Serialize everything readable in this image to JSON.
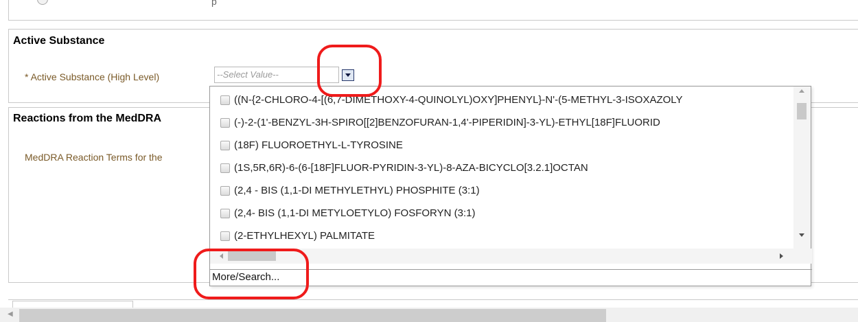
{
  "top_panel": {
    "text": "p"
  },
  "active_substance": {
    "title": "Active Substance",
    "field_label": "* Active Substance (High Level)",
    "select_placeholder": "--Select Value--"
  },
  "reactions": {
    "title": "Reactions from the MedDRA",
    "field_label": "MedDRA Reaction Terms for the"
  },
  "dropdown": {
    "options": [
      "((N-{2-CHLORO-4-[(6,7-DIMETHOXY-4-QUINOLYL)OXY]PHENYL}-N'-(5-METHYL-3-ISOXAZOLY",
      "(-)-2-(1'-BENZYL-3H-SPIRO[[2]BENZOFURAN-1,4'-PIPERIDIN]-3-YL)-ETHYL[18F]FLUORID",
      "(18F) FLUOROETHYL-L-TYROSINE",
      "(1S,5R,6R)-6-(6-[18F]FLUOR-PYRIDIN-3-YL)-8-AZA-BICYCLO[3.2.1]OCTAN",
      "(2,4 - BIS (1,1-DI METHYLETHYL) PHOSPHITE (3:1)",
      "(2,4- BIS (1,1-DI METYLOETYLO) FOSFORYN (3:1)",
      "(2-ETHYLHEXYL) PALMITATE"
    ],
    "more_search_label": "More/Search..."
  },
  "colors": {
    "annotation": "#ef1b1b",
    "label_text": "#7a5a28"
  }
}
